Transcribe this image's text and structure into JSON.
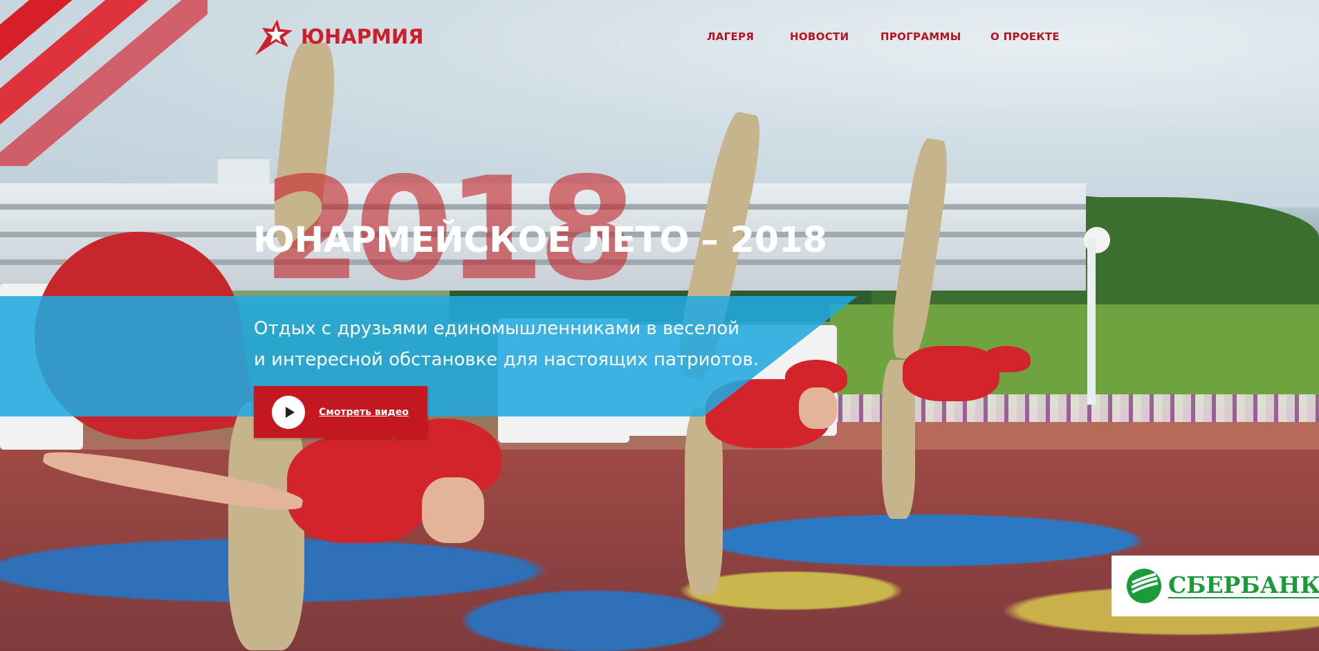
{
  "brand": {
    "name": "ЮНАРМИЯ",
    "color": "#cc1f2b",
    "icon": "star-flag-icon"
  },
  "nav": {
    "items": [
      {
        "label": "ЛАГЕРЯ"
      },
      {
        "label": "НОВОСТИ"
      },
      {
        "label": "ПРОГРАММЫ"
      },
      {
        "label": "О ПРОЕКТЕ"
      }
    ]
  },
  "hero": {
    "year_watermark": "2018",
    "title": "ЮНАРМЕЙСКОЕ ЛЕТО – 2018",
    "subtitle_line1": "Отдых с друзьями единомышленниками в веселой",
    "subtitle_line2": "и интересной обстановке для настоящих патриотов.",
    "band_color": "#22a8df",
    "video_button": {
      "label": "Смотреть видео",
      "icon": "play-icon",
      "color": "#c41720"
    }
  },
  "sponsor": {
    "name": "СБЕРБАНК",
    "color": "#1a9a3b",
    "icon": "sberbank-logo-icon"
  }
}
